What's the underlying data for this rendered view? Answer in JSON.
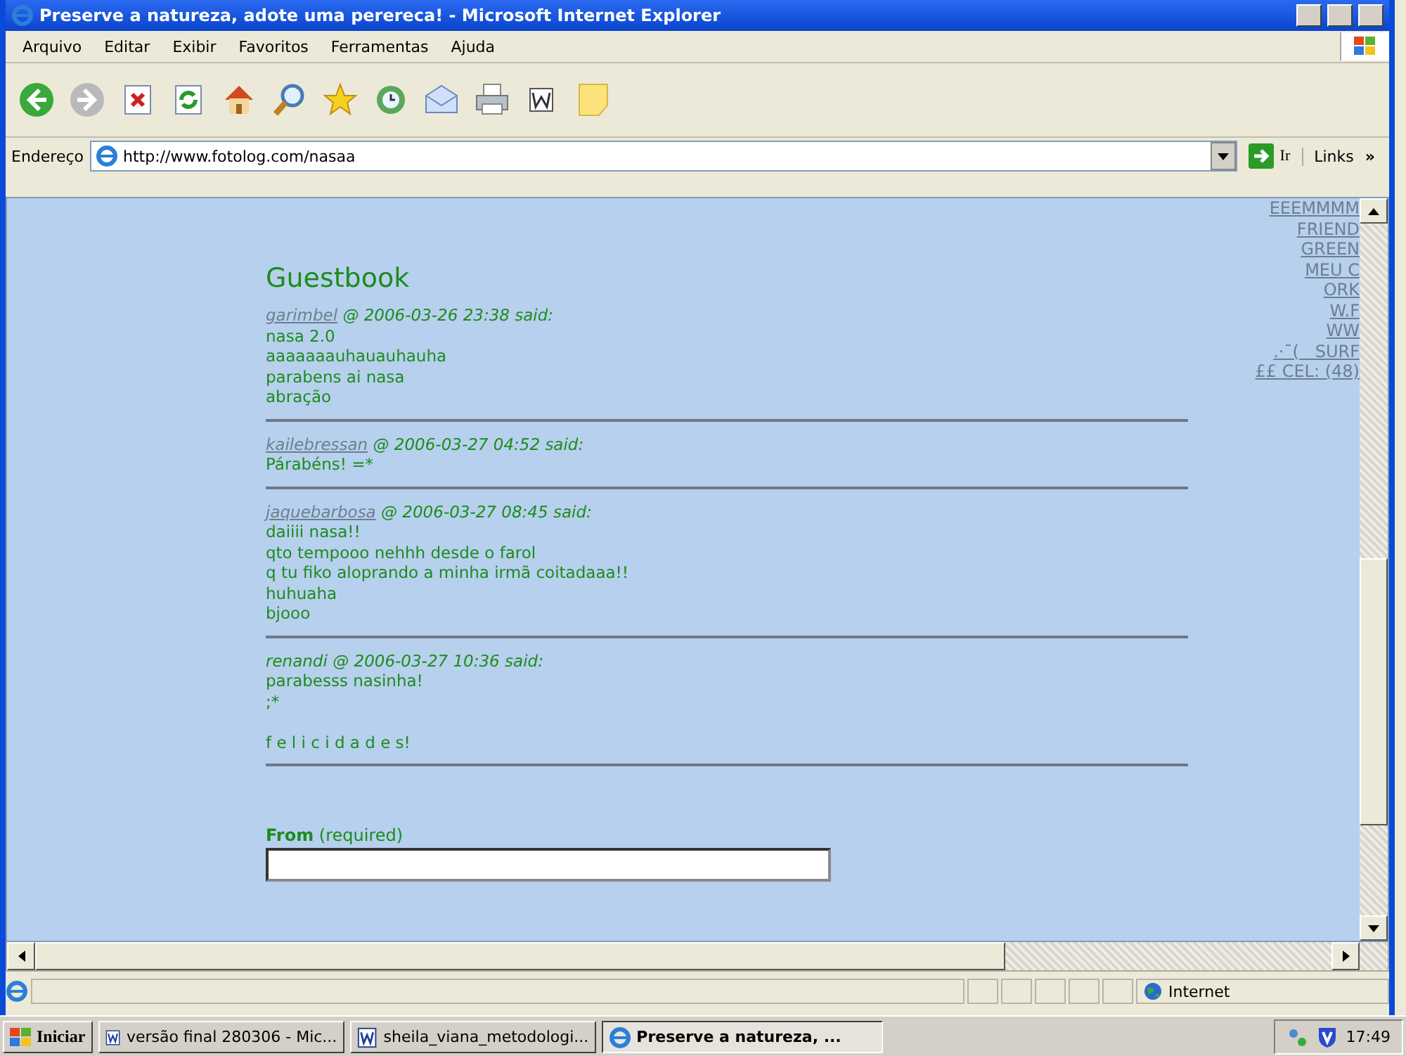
{
  "window": {
    "title": "Preserve a natureza, adote uma perereca! - Microsoft Internet Explorer"
  },
  "menu": [
    "Arquivo",
    "Editar",
    "Exibir",
    "Favoritos",
    "Ferramentas",
    "Ajuda"
  ],
  "address_bar": {
    "label": "Endereço",
    "url": "http://www.fotolog.com/nasaa",
    "go": "Ir",
    "links": "Links",
    "chevron": "»"
  },
  "guestbook": {
    "title": "Guestbook",
    "entries": [
      {
        "author": "garimbel",
        "linked": true,
        "meta": "@ 2006-03-26 23:38 said:",
        "lines": [
          "nasa 2.0",
          "aaaaaaauhauauhauha",
          "parabens ai nasa",
          "abração"
        ]
      },
      {
        "author": "kailebressan",
        "linked": true,
        "meta": "@ 2006-03-27 04:52 said:",
        "lines": [
          "Párabéns! =*"
        ]
      },
      {
        "author": "jaquebarbosa",
        "linked": true,
        "meta": "@ 2006-03-27 08:45 said:",
        "lines": [
          "daiiii nasa!!",
          "qto tempooo nehhh desde o farol",
          "q tu fiko aloprando a minha irmã coitadaaa!!",
          "huhuaha",
          "bjooo"
        ]
      },
      {
        "author": "renandi",
        "linked": false,
        "meta": "@ 2006-03-27 10:36 said:",
        "lines": [
          "parabesss nasinha!",
          ";*"
        ],
        "closing": "f e l i c i d a d e s!"
      }
    ],
    "form": {
      "label": "**From** (required)"
    }
  },
  "side_links": [
    "EEEMMMM",
    "FRIEND",
    "GREEN",
    "MEU C",
    "ORK",
    "W.F",
    "WW",
    ".·¯(   SURF",
    "££ CEL: (48)"
  ],
  "status_bar": {
    "zone": "Internet"
  },
  "taskbar": {
    "start": "Iniciar",
    "tasks": [
      {
        "label": "versão final 280306 - Mic...",
        "kind": "word",
        "selected": false
      },
      {
        "label": "sheila_viana_metodologi...",
        "kind": "word",
        "selected": false
      },
      {
        "label": "Preserve a natureza, ...",
        "kind": "browser",
        "selected": true
      }
    ],
    "clock": "17:49"
  }
}
